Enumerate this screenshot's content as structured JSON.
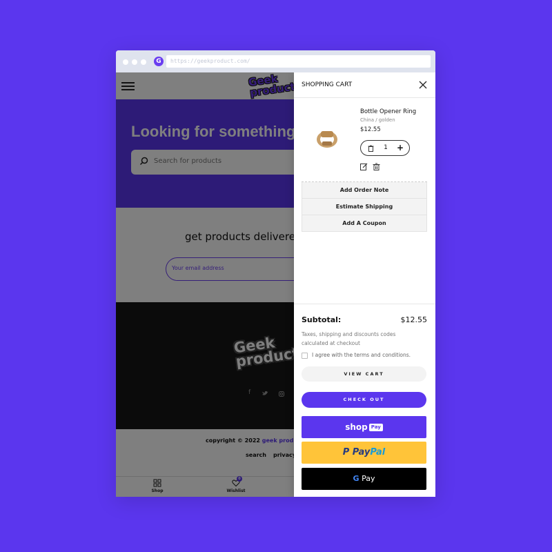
{
  "browser": {
    "url": "https://geekproduct.com/"
  },
  "site": {
    "logo": "Geek\nproduct",
    "hero_title": "Looking for something",
    "search_placeholder": "Search for products",
    "newsletter_title": "get products delivered",
    "email_placeholder": "Your email address",
    "copyright_prefix": "copyright © 2022",
    "copyright_brand": "geek product",
    "footer_links": [
      "search",
      "privacy"
    ],
    "tabs": [
      {
        "label": "Shop",
        "icon": "grid-icon"
      },
      {
        "label": "Wishlist",
        "icon": "heart-icon",
        "badge": "0"
      }
    ]
  },
  "cart": {
    "title": "SHOPPING CART",
    "item": {
      "name": "Bottle Opener Ring",
      "variant": "China / golden",
      "price": "$12.55",
      "quantity": "1"
    },
    "actions": [
      "Add Order Note",
      "Estimate Shipping",
      "Add A Coupon"
    ],
    "subtotal_label": "Subtotal:",
    "subtotal_value": "$12.55",
    "tax_note": "Taxes, shipping and discounts codes calculated at checkout",
    "terms_label": "I agree with the terms and conditions.",
    "view_cart_label": "VIEW CART",
    "checkout_label": "CHECK OUT",
    "shoppay": {
      "shop": "shop",
      "pay": "Pay"
    },
    "paypal": {
      "pay": "Pay",
      "pal": "Pal"
    },
    "gpay": {
      "g": "G",
      "pay": "Pay"
    }
  },
  "colors": {
    "background": "#5b36ee",
    "accent": "#5b36ee",
    "paypal_yellow": "#ffc439",
    "gpay_black": "#000000"
  }
}
